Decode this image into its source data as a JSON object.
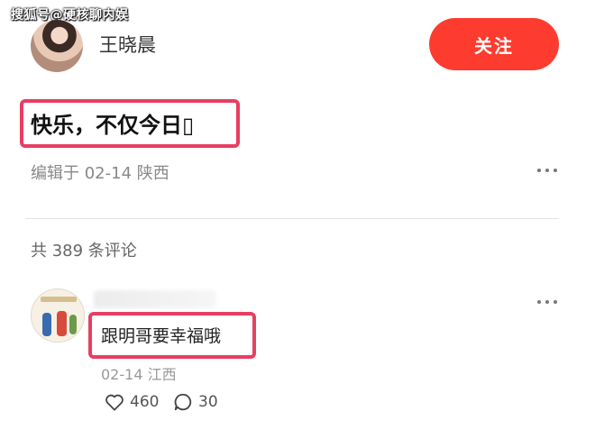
{
  "watermark": "搜狐号@硬核聊内娱",
  "author": {
    "name": "王晓晨",
    "follow_label": "关注"
  },
  "post": {
    "title": "快乐，不仅今日▯",
    "meta": "编辑于 02-14 陕西"
  },
  "comments": {
    "count_label": "共 389 条评论",
    "items": [
      {
        "text": "跟明哥要幸福哦",
        "meta": "02-14 江西",
        "likes": "460",
        "replies": "30"
      }
    ]
  },
  "colors": {
    "accent": "#fe3b2f",
    "highlight_border": "#e83e62"
  },
  "icons": {
    "more": "more-horizontal-icon",
    "like": "heart-outline-icon",
    "reply": "comment-bubble-icon"
  }
}
